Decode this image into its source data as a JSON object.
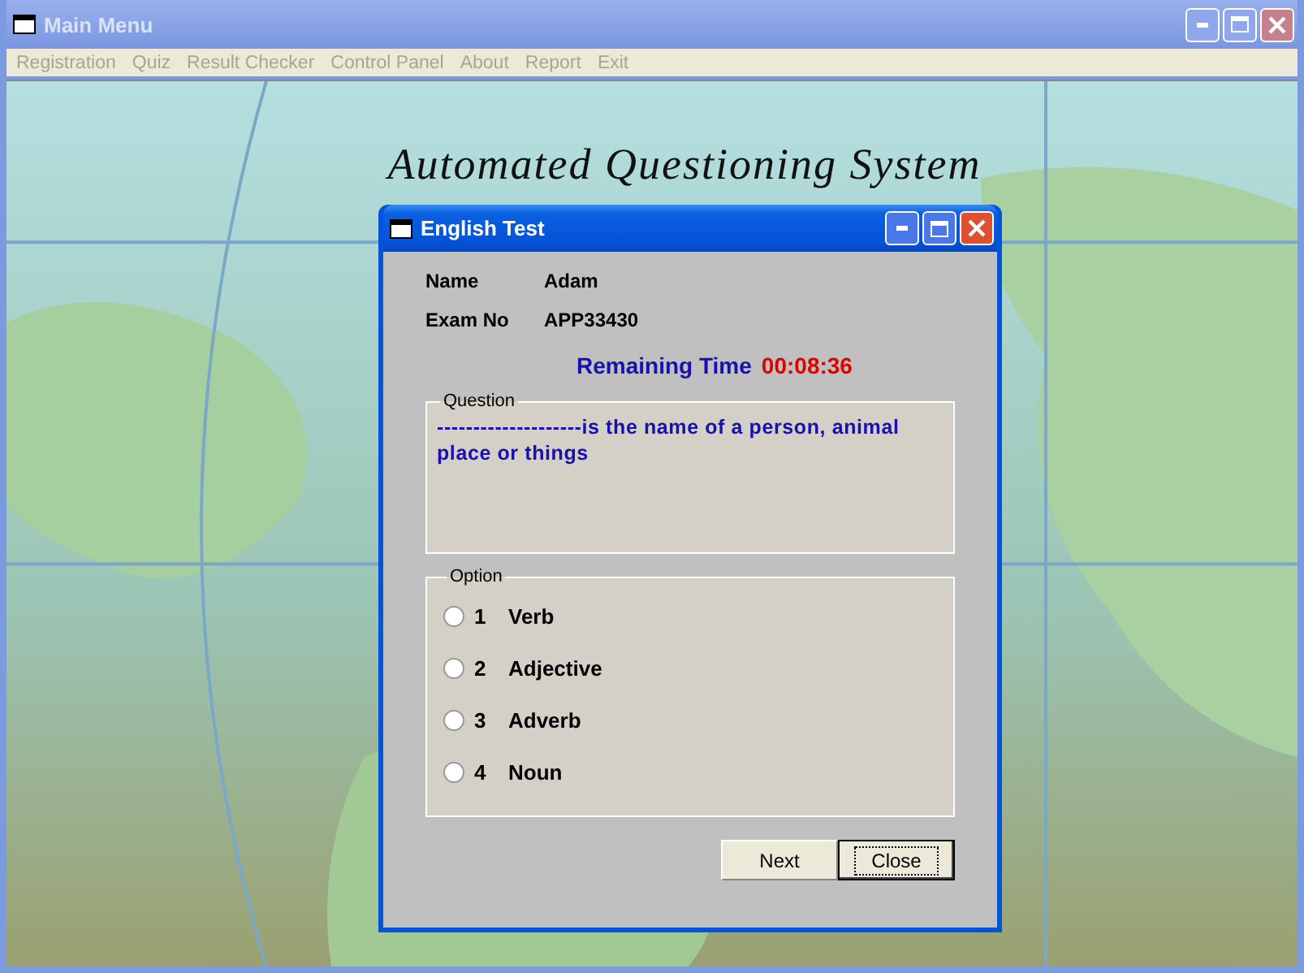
{
  "window": {
    "title": "Main Menu",
    "active": false
  },
  "menu": [
    {
      "label": "Registration",
      "disabled": true
    },
    {
      "label": "Quiz",
      "disabled": true
    },
    {
      "label": "Result Checker",
      "disabled": true
    },
    {
      "label": "Control Panel",
      "disabled": true
    },
    {
      "label": "About",
      "disabled": true
    },
    {
      "label": "Report",
      "disabled": true
    },
    {
      "label": "Exit",
      "disabled": true
    }
  ],
  "heading": "Automated Questioning System",
  "dialog": {
    "title": "English Test",
    "fields": [
      {
        "label": "Name",
        "value": "Adam"
      },
      {
        "label": "Exam No",
        "value": "APP33430"
      }
    ],
    "timer": {
      "label": "Remaining Time",
      "value": "00:08:36"
    },
    "question": {
      "legend": "Question",
      "text": "--------------------is the name of a person, animal place or things"
    },
    "options": {
      "legend": "Option",
      "items": [
        {
          "number": "1",
          "label": "Verb",
          "selected": false
        },
        {
          "number": "2",
          "label": "Adjective",
          "selected": false
        },
        {
          "number": "3",
          "label": "Adverb",
          "selected": false
        },
        {
          "number": "4",
          "label": "Noun",
          "selected": false
        }
      ]
    },
    "buttons": [
      {
        "label": "Next",
        "focused": false
      },
      {
        "label": "Close",
        "focused": true
      }
    ]
  }
}
